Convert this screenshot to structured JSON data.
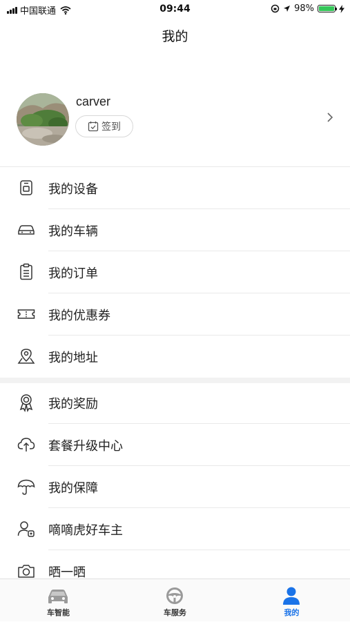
{
  "status_bar": {
    "carrier": "中国联通",
    "time": "09:44",
    "battery_percent": "98%",
    "battery_level": 0.98
  },
  "nav": {
    "title": "我的"
  },
  "profile": {
    "username": "carver",
    "checkin_label": "签到"
  },
  "menu_group_1": [
    {
      "label": "我的设备",
      "icon": "device-icon"
    },
    {
      "label": "我的车辆",
      "icon": "car-icon"
    },
    {
      "label": "我的订单",
      "icon": "order-clipboard-icon"
    },
    {
      "label": "我的优惠券",
      "icon": "coupon-ticket-icon"
    },
    {
      "label": "我的地址",
      "icon": "map-pin-icon"
    }
  ],
  "menu_group_2": [
    {
      "label": "我的奖励",
      "icon": "award-medal-icon"
    },
    {
      "label": "套餐升级中心",
      "icon": "cloud-upload-icon"
    },
    {
      "label": "我的保障",
      "icon": "umbrella-icon"
    },
    {
      "label": "嘀嘀虎好车主",
      "icon": "user-car-owner-icon"
    },
    {
      "label": "晒一晒",
      "icon": "camera-icon"
    }
  ],
  "tab_bar": {
    "tabs": [
      {
        "label": "车智能",
        "icon": "car-smart-icon",
        "active": false
      },
      {
        "label": "车服务",
        "icon": "steering-wheel-icon",
        "active": false
      },
      {
        "label": "我的",
        "icon": "person-icon",
        "active": true
      }
    ]
  },
  "colors": {
    "accent": "#1a73e8",
    "battery": "#34c759"
  }
}
